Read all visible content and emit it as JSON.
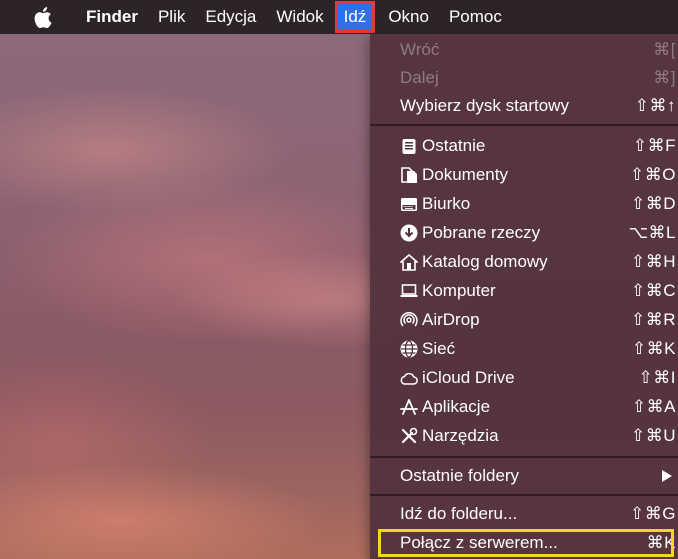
{
  "menubar": {
    "apple_icon": "apple-logo",
    "items": [
      {
        "label": "Finder",
        "bold": true
      },
      {
        "label": "Plik"
      },
      {
        "label": "Edycja"
      },
      {
        "label": "Widok"
      },
      {
        "label": "Idź",
        "active": true
      },
      {
        "label": "Okno"
      },
      {
        "label": "Pomoc"
      }
    ],
    "active_color": "#2f6fe8",
    "active_outline_color": "#e03b3b"
  },
  "go_menu": {
    "back": {
      "label": "Wróć",
      "shortcut": "⌘[",
      "disabled": true
    },
    "forward": {
      "label": "Dalej",
      "shortcut": "⌘]",
      "disabled": true
    },
    "startup_disk": {
      "label": "Wybierz dysk startowy",
      "shortcut": "⇧⌘↑"
    },
    "locations": [
      {
        "label": "Ostatnie",
        "shortcut": "⇧⌘F",
        "icon": "recents-icon"
      },
      {
        "label": "Dokumenty",
        "shortcut": "⇧⌘O",
        "icon": "documents-icon"
      },
      {
        "label": "Biurko",
        "shortcut": "⇧⌘D",
        "icon": "desktop-icon"
      },
      {
        "label": "Pobrane rzeczy",
        "shortcut": "⌥⌘L",
        "icon": "downloads-icon"
      },
      {
        "label": "Katalog domowy",
        "shortcut": "⇧⌘H",
        "icon": "home-icon"
      },
      {
        "label": "Komputer",
        "shortcut": "⇧⌘C",
        "icon": "computer-icon"
      },
      {
        "label": "AirDrop",
        "shortcut": "⇧⌘R",
        "icon": "airdrop-icon"
      },
      {
        "label": "Sieć",
        "shortcut": "⇧⌘K",
        "icon": "network-icon"
      },
      {
        "label": "iCloud Drive",
        "shortcut": "⇧⌘I",
        "icon": "icloud-icon"
      },
      {
        "label": "Aplikacje",
        "shortcut": "⇧⌘A",
        "icon": "applications-icon"
      },
      {
        "label": "Narzędzia",
        "shortcut": "⇧⌘U",
        "icon": "utilities-icon"
      }
    ],
    "recent_folders": {
      "label": "Ostatnie foldery"
    },
    "go_to_folder": {
      "label": "Idź do folderu...",
      "shortcut": "⇧⌘G"
    },
    "connect_to_server": {
      "label": "Połącz z serwerem...",
      "shortcut": "⌘K",
      "highlight_color": "#f1d81a"
    }
  }
}
